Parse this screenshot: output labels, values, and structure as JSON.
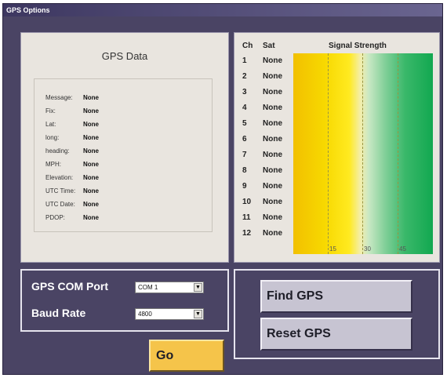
{
  "window": {
    "title": "GPS Options"
  },
  "gps_data": {
    "title": "GPS Data",
    "rows": [
      {
        "label": "Message:",
        "value": "None"
      },
      {
        "label": "Fix:",
        "value": "None"
      },
      {
        "label": "Lat:",
        "value": "None"
      },
      {
        "label": "long:",
        "value": "None"
      },
      {
        "label": "heading:",
        "value": "None"
      },
      {
        "label": "MPH:",
        "value": "None"
      },
      {
        "label": "Elevation:",
        "value": "None"
      },
      {
        "label": "UTC Time:",
        "value": "None"
      },
      {
        "label": "UTC Date:",
        "value": "None"
      },
      {
        "label": "PDOP:",
        "value": "None"
      }
    ]
  },
  "signal": {
    "header_ch": "Ch",
    "header_sat": "Sat",
    "header_strength": "Signal Strength",
    "channels": [
      {
        "ch": "1",
        "sat": "None"
      },
      {
        "ch": "2",
        "sat": "None"
      },
      {
        "ch": "3",
        "sat": "None"
      },
      {
        "ch": "4",
        "sat": "None"
      },
      {
        "ch": "5",
        "sat": "None"
      },
      {
        "ch": "6",
        "sat": "None"
      },
      {
        "ch": "7",
        "sat": "None"
      },
      {
        "ch": "8",
        "sat": "None"
      },
      {
        "ch": "9",
        "sat": "None"
      },
      {
        "ch": "10",
        "sat": "None"
      },
      {
        "ch": "11",
        "sat": "None"
      },
      {
        "ch": "12",
        "sat": "None"
      }
    ],
    "ticks": [
      "15",
      "30",
      "45"
    ]
  },
  "com": {
    "port_label": "GPS COM Port",
    "port_value": "COM 1",
    "baud_label": "Baud Rate",
    "baud_value": "4800"
  },
  "buttons": {
    "find": "Find GPS",
    "reset": "Reset GPS",
    "go": "Go"
  },
  "colors": {
    "window_bg": "#4a4464",
    "panel_bg": "#e9e5df",
    "go_button": "#f5c44a",
    "signal_low": "#f2c000",
    "signal_high": "#12a850"
  }
}
